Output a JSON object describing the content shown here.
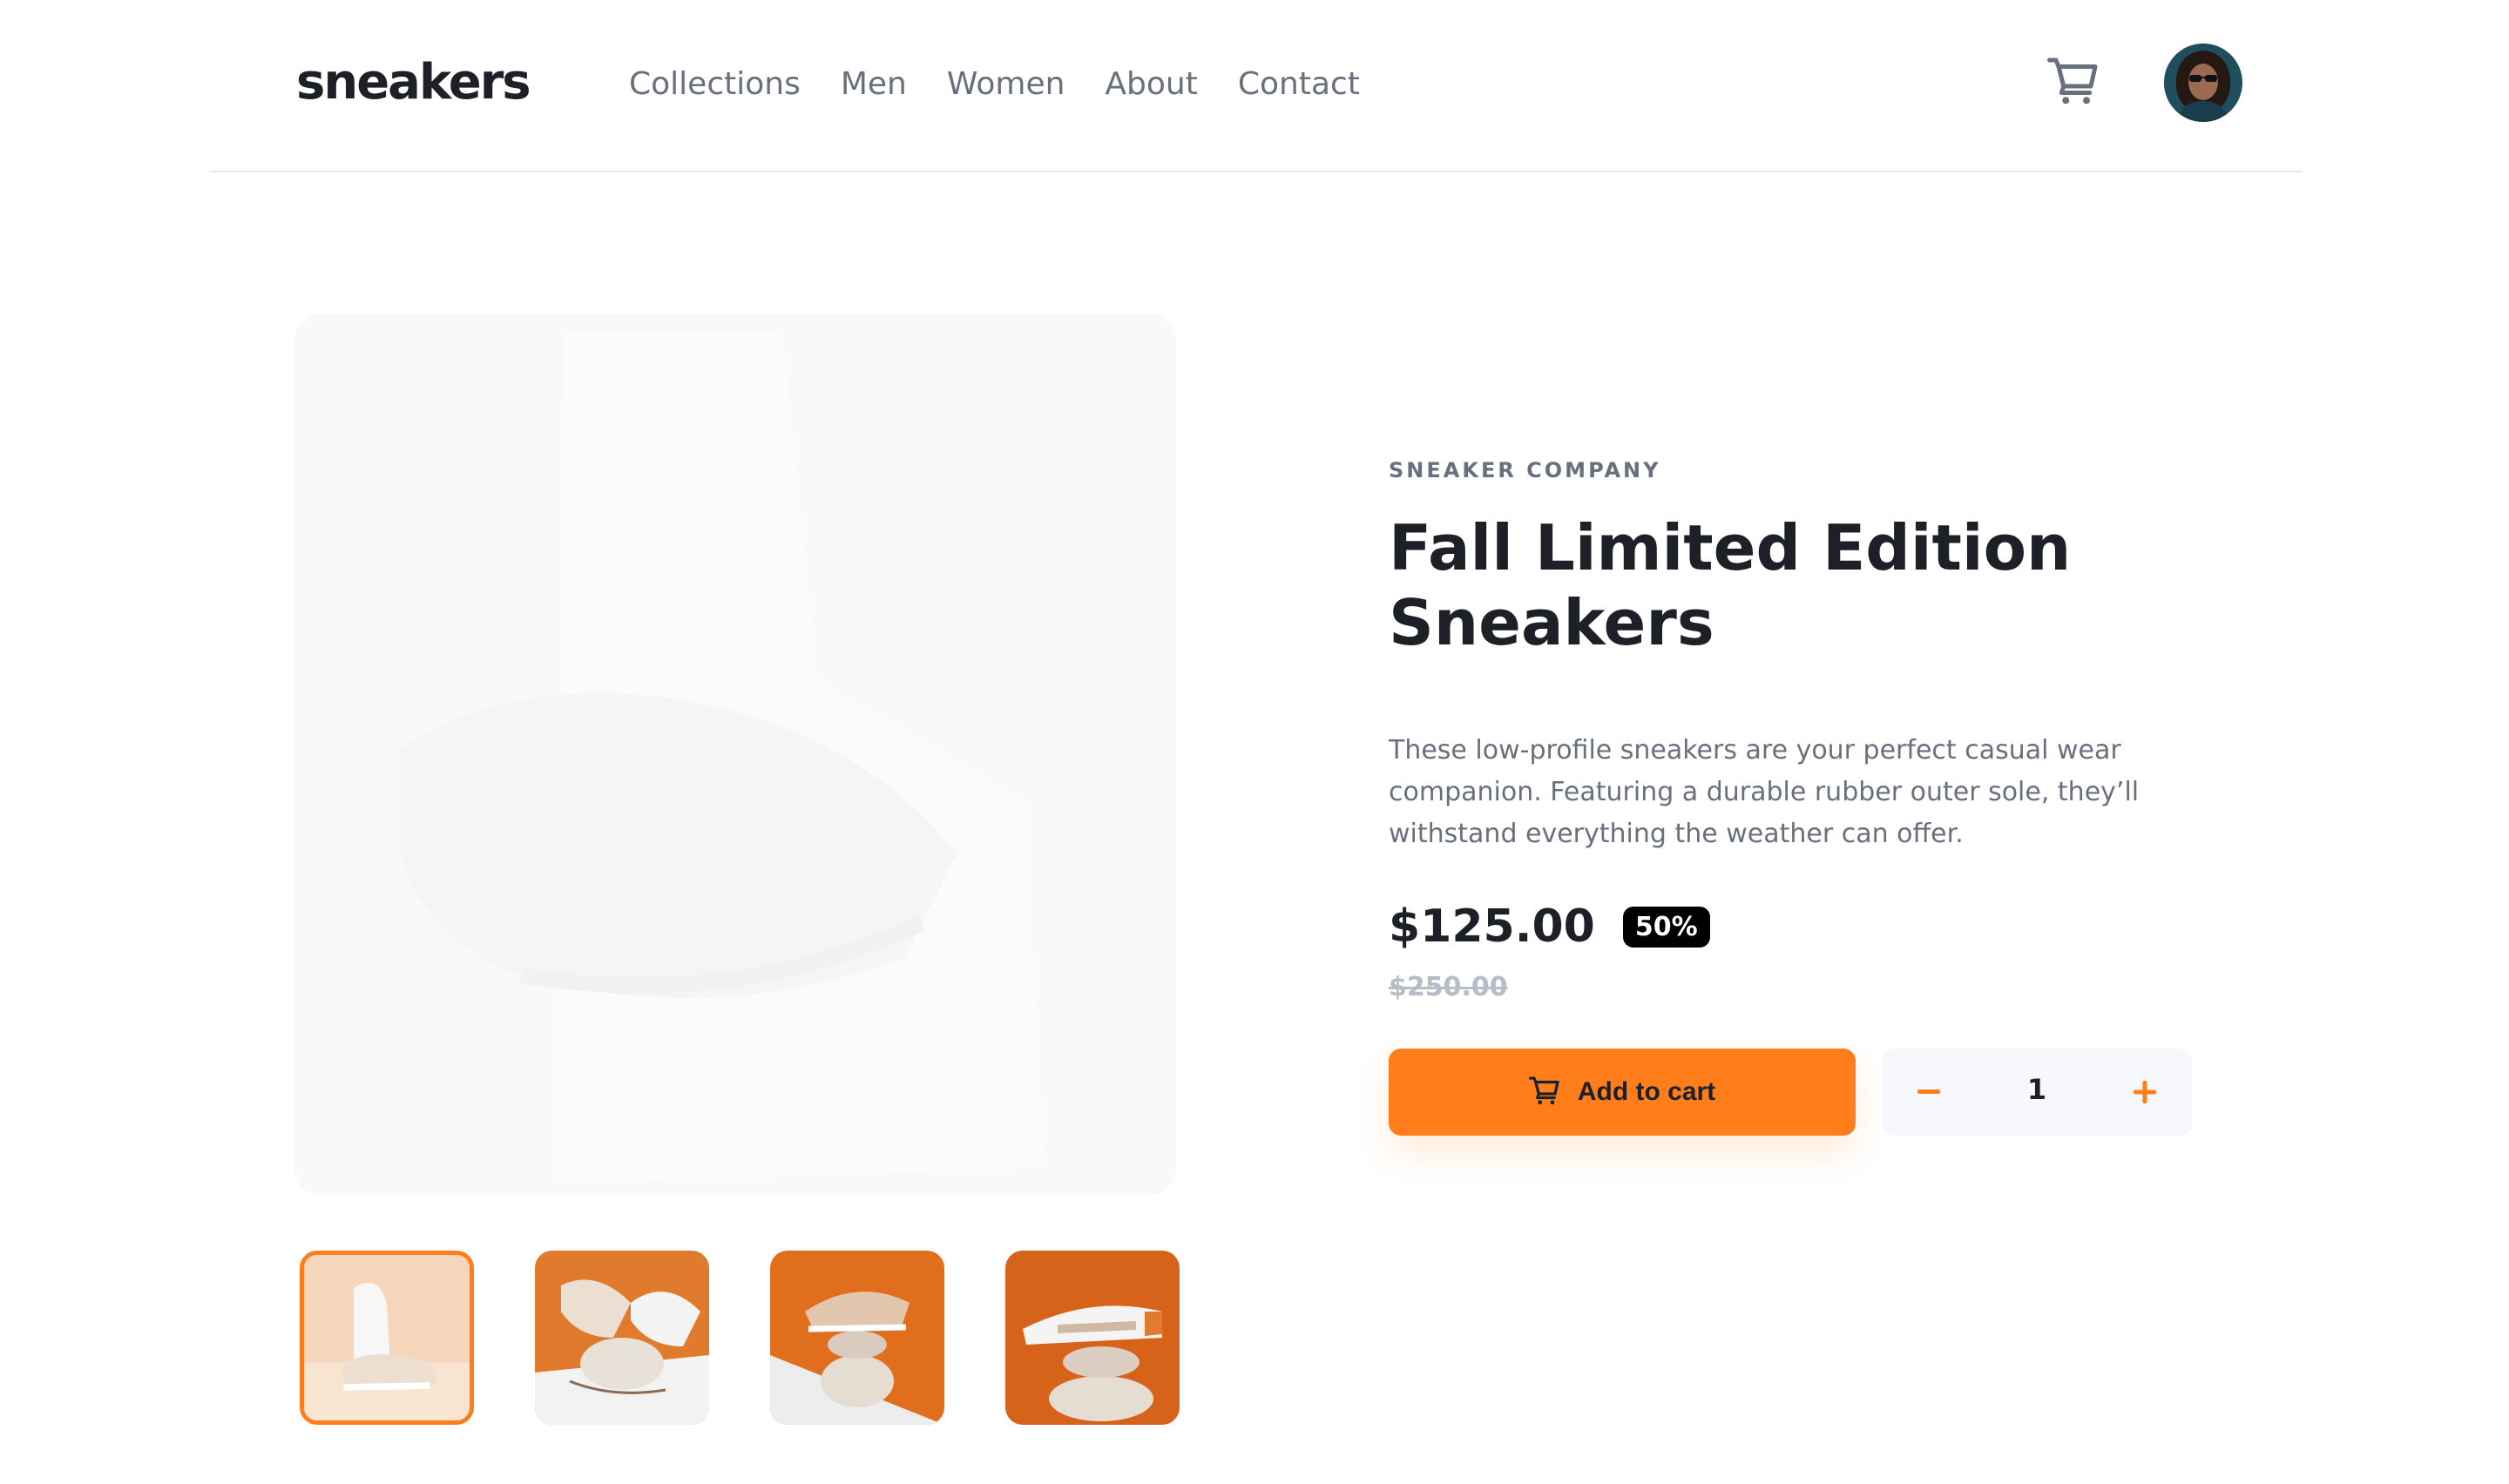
{
  "header": {
    "logo": "sneakers",
    "nav": [
      "Collections",
      "Men",
      "Women",
      "About",
      "Contact"
    ],
    "cart_icon": "cart-icon",
    "avatar_icon": "avatar"
  },
  "gallery": {
    "thumbnails": 4,
    "active_thumbnail": 1
  },
  "product": {
    "company": "SNEAKER COMPANY",
    "title_line1": "Fall Limited Edition",
    "title_line2": "Sneakers",
    "description": "These low-profile sneakers are your perfect casual wear companion. Featuring a durable rubber outer sole, they’ll withstand everything the weather can offer.",
    "price": "$125.00",
    "discount": "50%",
    "original_price": "$250.00"
  },
  "cart": {
    "quantity": "1",
    "add_label": "Add to cart"
  },
  "colors": {
    "accent": "#ff7e1b",
    "text_dark": "#1d2026",
    "text_muted": "#69707d"
  }
}
